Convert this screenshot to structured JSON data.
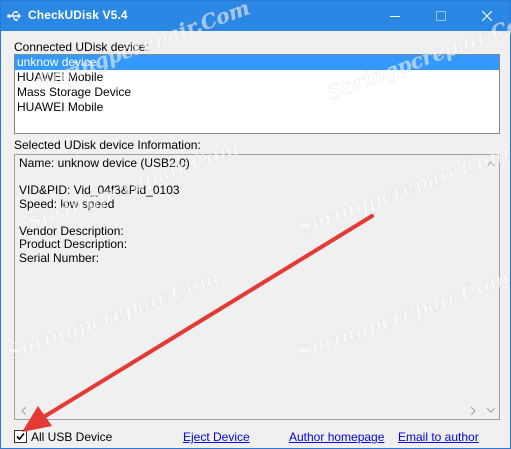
{
  "window": {
    "title": "CheckUDisk V5.4"
  },
  "labels": {
    "connected": "Connected UDisk device:",
    "selected_info": "Selected UDisk device Information:"
  },
  "devices": [
    {
      "label": "unknow device",
      "selected": true
    },
    {
      "label": "HUAWEI Mobile",
      "selected": false
    },
    {
      "label": "Mass Storage Device",
      "selected": false
    },
    {
      "label": "HUAWEI Mobile",
      "selected": false
    }
  ],
  "info_lines": [
    "Name: unknow device  (USB2.0)",
    "",
    "VID&PID: Vid_04f3&Pid_0103",
    "Speed: low speed",
    "",
    "Vendor Description:",
    "Product Description:",
    "Serial Number:"
  ],
  "bottom": {
    "all_usb_label": "All USB Device",
    "all_usb_checked": true,
    "eject_label": "Eject Device",
    "homepage_label": "Author homepage",
    "email_label": "Email to author"
  },
  "watermark": "Soringpcrepair.Com",
  "colors": {
    "titlebar": "#2b87e4",
    "selection": "#3399ff",
    "link": "#0000ee",
    "annotation_arrow": "#e53935"
  },
  "icons": {
    "app": "usb-icon",
    "minimize": "minimize-icon",
    "maximize": "maximize-icon",
    "close": "close-icon"
  }
}
